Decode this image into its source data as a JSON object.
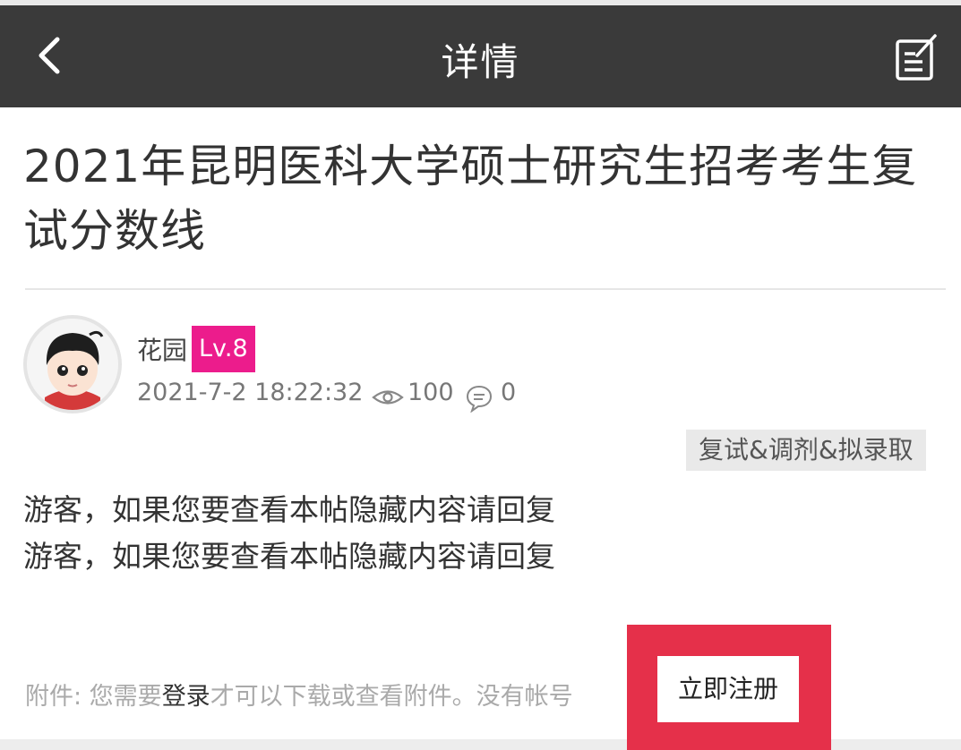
{
  "header": {
    "title": "详情",
    "back_icon": "chevron-left-icon",
    "compose_icon": "compose-icon"
  },
  "post": {
    "title": "2021年昆明医科大学硕士研究生招考考生复试分数线",
    "author": {
      "name": "花园",
      "level": "Lv.8",
      "avatar_icon": "avatar-cartoon-boy"
    },
    "timestamp": "2021-7-2 18:22:32",
    "views": "100",
    "replies": "0",
    "tag": "复试&调剂&拟录取",
    "content_lines": [
      "游客，如果您要查看本帖隐藏内容请回复",
      "游客，如果您要查看本帖隐藏内容请回复"
    ],
    "attachment": {
      "prefix": "附件: 您需要",
      "login_link": "登录",
      "suffix": "才可以下载或查看附件。没有帐号",
      "register_label": "立即注册"
    }
  },
  "colors": {
    "header_bg": "#3a3a3a",
    "level_badge": "#ec1c8c",
    "highlight_frame": "#e5304a"
  }
}
